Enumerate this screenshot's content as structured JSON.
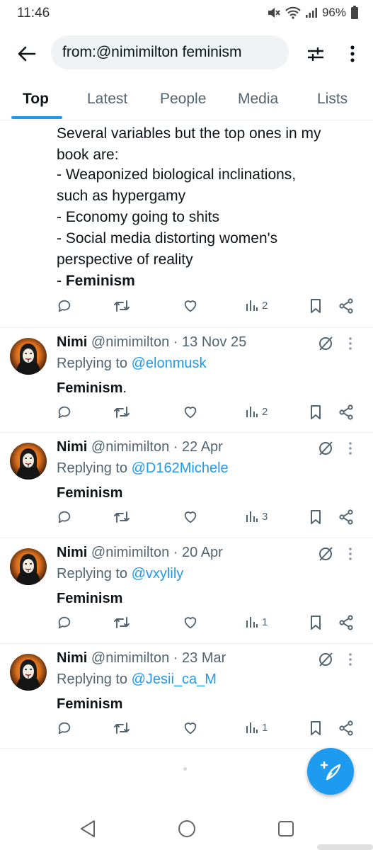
{
  "status": {
    "time": "11:46",
    "battery": "96%"
  },
  "header": {
    "search_query": "from:@nimimilton feminism"
  },
  "tabs": [
    "Top",
    "Latest",
    "People",
    "Media",
    "Lists"
  ],
  "active_tab": "Top",
  "first_post": {
    "line1": "Several variables but the top ones in my",
    "line2": "book are:",
    "line3": "- Weaponized biological inclinations,",
    "line4": "such as hypergamy",
    "line5": "- Economy going to shits",
    "line6": "- Social media distorting women's",
    "line7": "perspective of reality",
    "line8_prefix": "- ",
    "line8_bold": "Feminism",
    "views": "2"
  },
  "tweets": [
    {
      "name": "Nimi",
      "handle": "@nimimilton",
      "date": "· 13 Nov 25",
      "replying_label": "Replying to",
      "replying_to": "@elonmusk",
      "text_bold": "Feminism",
      "text_plain": ".",
      "views": "2"
    },
    {
      "name": "Nimi",
      "handle": "@nimimilton",
      "date": "· 22 Apr",
      "replying_label": "Replying to",
      "replying_to": "@D162Michele",
      "text_bold": "Feminism",
      "text_plain": "",
      "views": "3"
    },
    {
      "name": "Nimi",
      "handle": "@nimimilton",
      "date": "· 20 Apr",
      "replying_label": "Replying to",
      "replying_to": "@vxylily",
      "text_bold": "Feminism",
      "text_plain": "",
      "views": "1"
    },
    {
      "name": "Nimi",
      "handle": "@nimimilton",
      "date": "· 23 Mar",
      "replying_label": "Replying to",
      "replying_to": "@Jesii_ca_M",
      "text_bold": "Feminism",
      "text_plain": "",
      "views": "1"
    }
  ],
  "icons": {
    "back": "arrow-left-icon",
    "filter": "sliders-icon",
    "more": "kebab-icon",
    "reply": "comment-icon",
    "retweet": "retweet-icon",
    "like": "heart-icon",
    "views": "bar-chart-icon",
    "bookmark": "bookmark-icon",
    "share": "share-icon",
    "grok": "grok-icon",
    "compose": "compose-feather-icon"
  },
  "colors": {
    "accent": "#1d9bf0",
    "text": "#0f1419",
    "secondary": "#536471",
    "search_bg": "#eff3f4"
  }
}
